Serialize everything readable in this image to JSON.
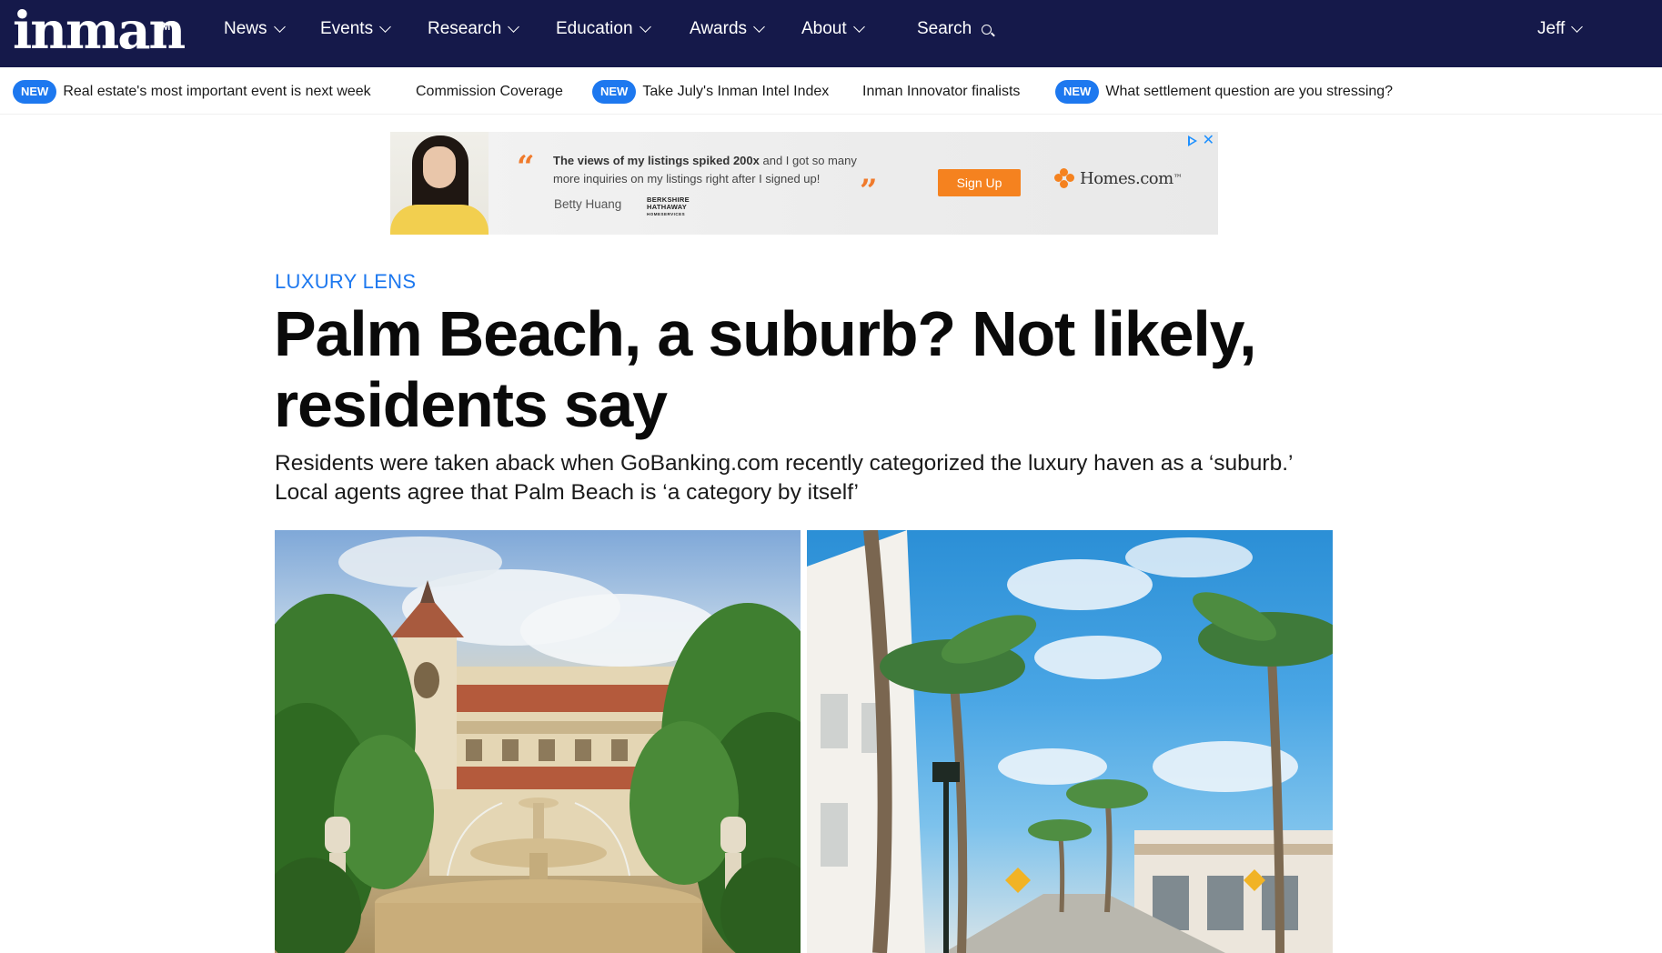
{
  "nav": {
    "logo": "inman",
    "logo_tm": "TM",
    "items": [
      {
        "label": "News"
      },
      {
        "label": "Events"
      },
      {
        "label": "Research"
      },
      {
        "label": "Education"
      },
      {
        "label": "Awards"
      },
      {
        "label": "About"
      }
    ],
    "search_label": "Search",
    "user_label": "Jeff"
  },
  "ticker": [
    {
      "badge": "NEW",
      "text": "Real estate's most important event is next week"
    },
    {
      "badge": "",
      "text": "Commission Coverage"
    },
    {
      "badge": "NEW",
      "text": "Take July's Inman Intel Index"
    },
    {
      "badge": "",
      "text": "Inman Innovator finalists"
    },
    {
      "badge": "NEW",
      "text": "What settlement question are you stressing?"
    }
  ],
  "ad": {
    "quote_bold": "The views of my listings spiked 200x",
    "quote_rest": " and I got so many more inquiries on my listings right after I signed up!",
    "author": "Betty Huang",
    "brokerage_line1": "BERKSHIRE",
    "brokerage_line2": "HATHAWAY",
    "brokerage_line3": "HOMESERVICES",
    "cta": "Sign Up",
    "brand": "Homes.com",
    "brand_tm": "™",
    "close": "✕"
  },
  "article": {
    "kicker": "LUXURY LENS",
    "headline": "Palm Beach, a suburb? Not likely, residents say",
    "dek": "Residents were taken aback when GoBanking.com recently categorized the luxury haven as a ‘suburb.’ Local agents agree that Palm Beach is ‘a category by itself’"
  },
  "colors": {
    "nav_bg": "#15194a",
    "accent_blue": "#1d78ef",
    "ad_orange": "#f5821f"
  }
}
